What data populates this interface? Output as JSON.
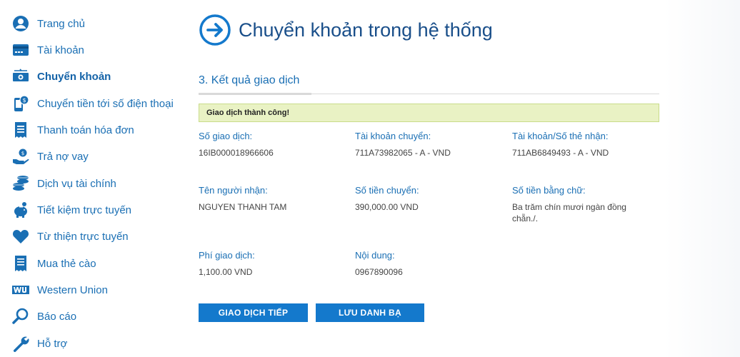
{
  "sidebar": {
    "items": [
      {
        "label": "Trang chủ",
        "icon": "user-icon"
      },
      {
        "label": "Tài khoản",
        "icon": "card-icon"
      },
      {
        "label": "Chuyển khoản",
        "icon": "money-transfer-icon",
        "active": true
      },
      {
        "label": "Chuyển tiền tới số điện thoại",
        "icon": "phone-money-icon"
      },
      {
        "label": "Thanh toán hóa đơn",
        "icon": "receipt-icon"
      },
      {
        "label": "Trả nợ vay",
        "icon": "hand-coin-icon"
      },
      {
        "label": "Dịch vụ tài chính",
        "icon": "coins-stack-icon"
      },
      {
        "label": "Tiết kiệm trực tuyến",
        "icon": "piggy-bank-icon"
      },
      {
        "label": "Từ thiện trực tuyến",
        "icon": "heart-icon"
      },
      {
        "label": "Mua thẻ cào",
        "icon": "scratch-card-icon"
      },
      {
        "label": "Western Union",
        "icon": "western-union-icon"
      },
      {
        "label": "Báo cáo",
        "icon": "magnifier-icon"
      },
      {
        "label": "Hỗ trợ",
        "icon": "wrench-icon"
      }
    ]
  },
  "header": {
    "title": "Chuyển khoản trong hệ thống",
    "icon": "arrow-right-circle-icon"
  },
  "step": {
    "title": "3. Kết quả giao dịch"
  },
  "status": {
    "message": "Giao dịch thành công!"
  },
  "details": {
    "transaction_no_label": "Số giao dịch:",
    "transaction_no": "16IB000018966606",
    "from_account_label": "Tài khoản chuyển:",
    "from_account": "711A73982065 - A - VND",
    "to_account_label": "Tài khoản/Số thẻ nhận:",
    "to_account": "711AB6849493 - A - VND",
    "recipient_label": "Tên người nhận:",
    "recipient": "NGUYEN THANH TAM",
    "amount_label": "Số tiền chuyển:",
    "amount": "390,000.00 VND",
    "amount_words_label": "Số tiền bằng chữ:",
    "amount_words": "Ba trăm chín mươi ngàn đồng chẵn./.",
    "fee_label": "Phí giao dịch:",
    "fee": "1,100.00 VND",
    "content_label": "Nội dung:",
    "content": "0967890096"
  },
  "actions": {
    "next_transaction": "GIAO DỊCH TIẾP",
    "save_contact": "LƯU DANH BẠ"
  },
  "colors": {
    "primary": "#1479cc",
    "link": "#1a6fb4",
    "success_bg": "#e9f2c4"
  }
}
